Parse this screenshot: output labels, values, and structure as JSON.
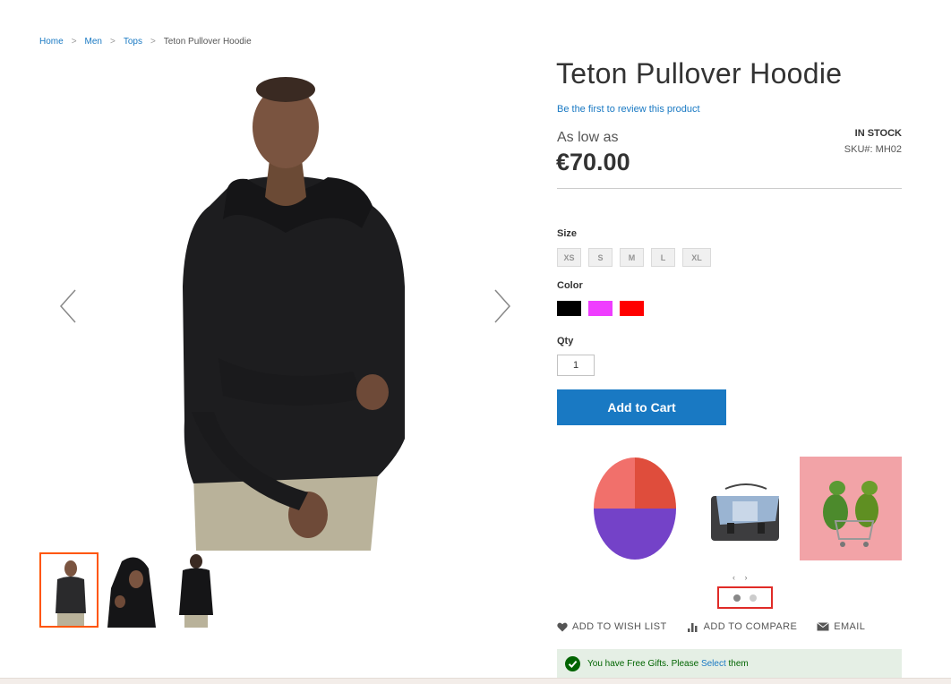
{
  "breadcrumb": {
    "items": [
      "Home",
      "Men",
      "Tops"
    ],
    "current": "Teton Pullover Hoodie",
    "separator": ">"
  },
  "product": {
    "title": "Teton Pullover Hoodie",
    "review_link": "Be the first to review this product",
    "price_prefix": "As low as",
    "price": "€70.00",
    "stock": "IN STOCK",
    "sku_label": "SKU#:",
    "sku": "MH02"
  },
  "options": {
    "size_label": "Size",
    "sizes": [
      "XS",
      "S",
      "M",
      "L",
      "XL"
    ],
    "color_label": "Color",
    "colors": [
      "#000000",
      "#ef3dff",
      "#ff0000"
    ],
    "qty_label": "Qty",
    "qty_value": "1"
  },
  "cart": {
    "add_label": "Add to Cart"
  },
  "carousel": {
    "arrows": "‹ ›",
    "dot_count": 2,
    "active_dot": 0
  },
  "actions": {
    "wishlist": "ADD TO WISH LIST",
    "compare": "ADD TO COMPARE",
    "email": "EMAIL"
  },
  "gift_message": {
    "text": "You have Free Gifts. Please",
    "link": "Select",
    "suffix": "them"
  },
  "colors": {
    "accent": "#1979c3",
    "active_thumb": "#ff5501",
    "highlight": "#e02b27"
  }
}
